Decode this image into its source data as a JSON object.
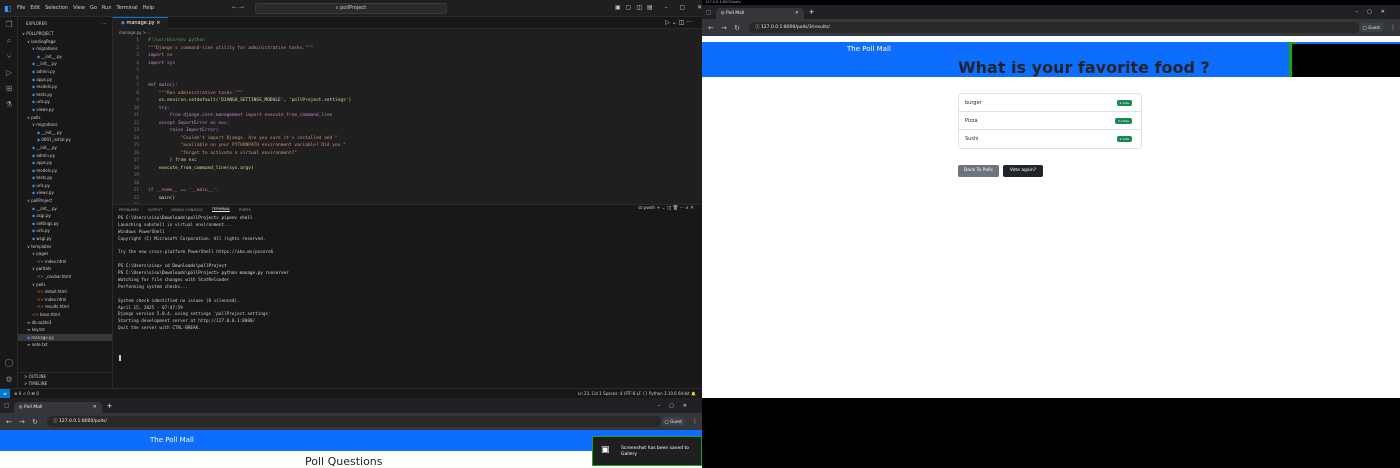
{
  "vscode": {
    "menus": [
      "File",
      "Edit",
      "Selection",
      "View",
      "Go",
      "Run",
      "Terminal",
      "Help"
    ],
    "search": "pollProject",
    "sidebar": {
      "header": "EXPLORER",
      "items": [
        {
          "t": "∨ POLLPROJECT",
          "ind": 0,
          "c": ""
        },
        {
          "t": "∨ landingPage",
          "ind": 1,
          "c": ""
        },
        {
          "t": "∨ migrations",
          "ind": 2,
          "c": ""
        },
        {
          "t": "__init__.py",
          "ind": 3,
          "c": "py"
        },
        {
          "t": "__init__.py",
          "ind": 2,
          "c": "py"
        },
        {
          "t": "admin.py",
          "ind": 2,
          "c": "py"
        },
        {
          "t": "apps.py",
          "ind": 2,
          "c": "py"
        },
        {
          "t": "models.py",
          "ind": 2,
          "c": "py"
        },
        {
          "t": "tests.py",
          "ind": 2,
          "c": "py"
        },
        {
          "t": "urls.py",
          "ind": 2,
          "c": "py"
        },
        {
          "t": "views.py",
          "ind": 2,
          "c": "py"
        },
        {
          "t": "∨ polls",
          "ind": 1,
          "c": ""
        },
        {
          "t": "∨ migrations",
          "ind": 2,
          "c": ""
        },
        {
          "t": "__init__.py",
          "ind": 3,
          "c": "py"
        },
        {
          "t": "0001_initial.py",
          "ind": 3,
          "c": "py"
        },
        {
          "t": "__init__.py",
          "ind": 2,
          "c": "py"
        },
        {
          "t": "admin.py",
          "ind": 2,
          "c": "py"
        },
        {
          "t": "apps.py",
          "ind": 2,
          "c": "py"
        },
        {
          "t": "models.py",
          "ind": 2,
          "c": "py"
        },
        {
          "t": "tests.py",
          "ind": 2,
          "c": "py"
        },
        {
          "t": "urls.py",
          "ind": 2,
          "c": "py"
        },
        {
          "t": "views.py",
          "ind": 2,
          "c": "py"
        },
        {
          "t": "∨ pollProject",
          "ind": 1,
          "c": ""
        },
        {
          "t": "__init__.py",
          "ind": 2,
          "c": "py"
        },
        {
          "t": "asgi.py",
          "ind": 2,
          "c": "py"
        },
        {
          "t": "settings.py",
          "ind": 2,
          "c": "py"
        },
        {
          "t": "urls.py",
          "ind": 2,
          "c": "py"
        },
        {
          "t": "wsgi.py",
          "ind": 2,
          "c": "py"
        },
        {
          "t": "∨ templates",
          "ind": 1,
          "c": ""
        },
        {
          "t": "∨ pages",
          "ind": 2,
          "c": ""
        },
        {
          "t": "index.html",
          "ind": 3,
          "c": "html"
        },
        {
          "t": "∨ partials",
          "ind": 2,
          "c": ""
        },
        {
          "t": "_navbar.html",
          "ind": 3,
          "c": "html"
        },
        {
          "t": "∨ polls",
          "ind": 2,
          "c": ""
        },
        {
          "t": "detail.html",
          "ind": 3,
          "c": "html"
        },
        {
          "t": "index.html",
          "ind": 3,
          "c": "html"
        },
        {
          "t": "results.html",
          "ind": 3,
          "c": "html"
        },
        {
          "t": "base.html",
          "ind": 2,
          "c": "html"
        },
        {
          "t": "db.sqlite3",
          "ind": 1,
          "c": "db"
        },
        {
          "t": "key.txt",
          "ind": 1,
          "c": "txt"
        },
        {
          "t": "manage.py",
          "ind": 1,
          "c": "py",
          "sel": true
        },
        {
          "t": "note.txt",
          "ind": 1,
          "c": "txt"
        }
      ],
      "outline": "> OUTLINE",
      "timeline": "> TIMELINE"
    },
    "tab": "manage.py",
    "breadcrumb": "manage.py > ...",
    "code": [
      "#!/usr/bin/env python",
      "\"\"\"Django's command-line utility for administrative tasks.\"\"\"",
      "import os",
      "import sys",
      "",
      "",
      "def main():",
      "    \"\"\"Run administrative tasks.\"\"\"",
      "    os.environ.setdefault('DJANGO_SETTINGS_MODULE', 'pollProject.settings')",
      "    try:",
      "        from django.core.management import execute_from_command_line",
      "    except ImportError as exc:",
      "        raise ImportError(",
      "            \"Couldn't import Django. Are you sure it's installed and \"",
      "            \"available on your PYTHONPATH environment variable? Did you \"",
      "            \"forget to activate a virtual environment?\"",
      "        ) from exc",
      "    execute_from_command_line(sys.argv)",
      "",
      "",
      "if __name__ == '__main__':",
      "    main()",
      ""
    ],
    "panel_tabs": [
      "PROBLEMS",
      "OUTPUT",
      "DEBUG CONSOLE",
      "TERMINAL",
      "PORTS"
    ],
    "panel_actions": "⊡ pwsh  +  ⌄  ◫  🗑  ···  ∧  ✕",
    "terminal": [
      "PS C:\\Users\\sisu\\Downloads\\pollProject> pipenv shell",
      "Launching subshell in virtual environment...",
      "Windows PowerShell",
      "Copyright (C) Microsoft Corporation. All rights reserved.",
      "",
      "Try the new cross-platform PowerShell https://aka.ms/pscore6",
      "",
      "PS C:\\Users\\sisu> cd Downloads\\pollProject",
      "PS C:\\Users\\sisu\\Downloads\\pollProject> python manage.py runserver",
      "Watching for file changes with StatReloader",
      "Performing system checks...",
      "",
      "System check identified no issues (0 silenced).",
      "April 15, 2025 - 07:47:59",
      "Django version 5.0.4, using settings 'pollProject.settings'",
      "Starting development server at http://127.0.0.1:8000/",
      "Quit the server with CTRL-BREAK."
    ],
    "status_left": "⊗ 0 ⚠ 0   ⌘ 0",
    "status_right": "Ln 23, Col 1   Spaces: 4   UTF-8   LF   {} Python   3.10.6 64-bit   🔔"
  },
  "browser1": {
    "strip": "127.0.0.1:8000/polls",
    "tab": "Poll Mall",
    "url": "127.0.0.1:8000/polls/3/results/",
    "guest": "Guest",
    "brand": "The Poll Mall",
    "title": "What is your favorite food ?",
    "results": [
      {
        "name": "burger",
        "votes": "1 vote"
      },
      {
        "name": "Pizza",
        "votes": "2 votes"
      },
      {
        "name": "Sushi",
        "votes": "1 vote"
      }
    ],
    "back_btn": "Back To Polls",
    "vote_btn": "Vote again?"
  },
  "browser2": {
    "tab": "Poll Mall",
    "url": "127.0.0.1:8000/polls/",
    "guest": "Guest",
    "brand": "The Poll Mall",
    "title": "Poll Questions",
    "toast": "Screenshot has been saved to Gallery"
  },
  "colors": {
    "brand": "#0d6efd",
    "success": "#198754",
    "editor_bg": "#1f1f1f",
    "accent": "#0078d4"
  }
}
